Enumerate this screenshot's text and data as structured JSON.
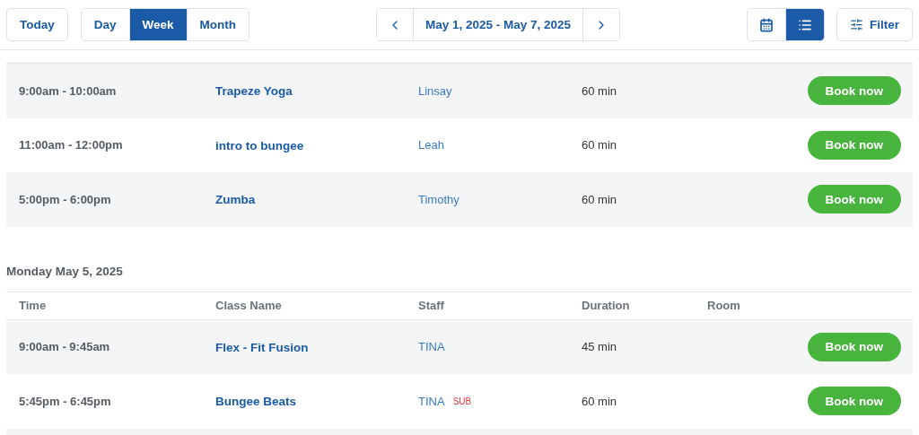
{
  "toolbar": {
    "today": "Today",
    "view_modes": [
      {
        "label": "Day",
        "selected": false
      },
      {
        "label": "Week",
        "selected": true
      },
      {
        "label": "Month",
        "selected": false
      }
    ],
    "date_range": "May 1, 2025 - May 7, 2025",
    "display_modes": [
      {
        "kind": "calendar",
        "selected": false
      },
      {
        "kind": "list",
        "selected": true
      }
    ],
    "filter": "Filter"
  },
  "days": [
    {
      "rows": [
        {
          "time": "9:00am - 10:00am",
          "class_name": "Trapeze Yoga",
          "staff": "Linsay",
          "duration": "60 min",
          "action": "Book now"
        },
        {
          "time": "11:00am - 12:00pm",
          "class_name": "intro to bungee",
          "staff": "Leah",
          "duration": "60 min",
          "action": "Book now"
        },
        {
          "time": "5:00pm - 6:00pm",
          "class_name": "Zumba",
          "staff": "Timothy",
          "duration": "60 min",
          "action": "Book now"
        }
      ]
    },
    {
      "heading": "Monday May 5, 2025",
      "columns": [
        "Time",
        "Class Name",
        "Staff",
        "Duration",
        "Room"
      ],
      "rows": [
        {
          "time": "9:00am - 9:45am",
          "class_name": "Flex - Fit Fusion",
          "staff": "TINA",
          "duration": "45 min",
          "action": "Book now"
        },
        {
          "time": "5:45pm - 6:45pm",
          "class_name": "Bungee Beats",
          "staff": "TINA",
          "badge": "SUB",
          "duration": "60 min",
          "action": "Book now"
        }
      ]
    }
  ]
}
